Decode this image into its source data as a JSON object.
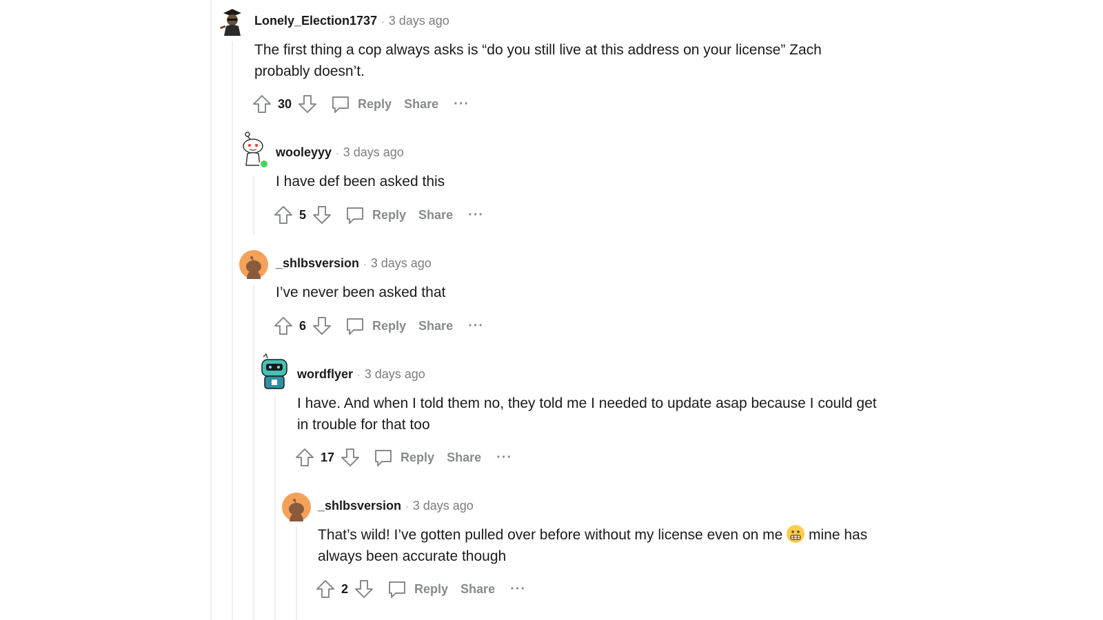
{
  "comments": [
    {
      "username": "Lonely_Election1737",
      "separator": "·",
      "time": "3 days ago",
      "body": "The first thing a cop always asks is “do you still live at this address on your license” Zach probably doesn’t.",
      "score": "30",
      "reply_label": "Reply",
      "share_label": "Share",
      "more_label": "···"
    },
    {
      "username": "wooleyyy",
      "separator": "·",
      "time": "3 days ago",
      "body": "I have def been asked this",
      "score": "5",
      "reply_label": "Reply",
      "share_label": "Share",
      "more_label": "···"
    },
    {
      "username": "_shlbsversion",
      "separator": "·",
      "time": "3 days ago",
      "body": "I’ve never been asked that",
      "score": "6",
      "reply_label": "Reply",
      "share_label": "Share",
      "more_label": "···"
    },
    {
      "username": "wordflyer",
      "separator": "·",
      "time": "3 days ago",
      "body": "I have. And when I told them no, they told me I needed to update asap because I could get in trouble for that too",
      "score": "17",
      "reply_label": "Reply",
      "share_label": "Share",
      "more_label": "···"
    },
    {
      "username": "_shlbsversion",
      "separator": "·",
      "time": "3 days ago",
      "body_before_emoji": "That’s wild! I’ve gotten pulled over before without my license even on me ",
      "emoji": "grimacing-face",
      "body_after_emoji": " mine has always been accurate though",
      "score": "2",
      "reply_label": "Reply",
      "share_label": "Share",
      "more_label": "···"
    }
  ],
  "colors": {
    "thread_line": "#edeff1",
    "meta_text": "#7c7c7c",
    "action_text": "#878a8c",
    "online_dot": "#46d160",
    "avatar_orange": "#f4a259"
  }
}
